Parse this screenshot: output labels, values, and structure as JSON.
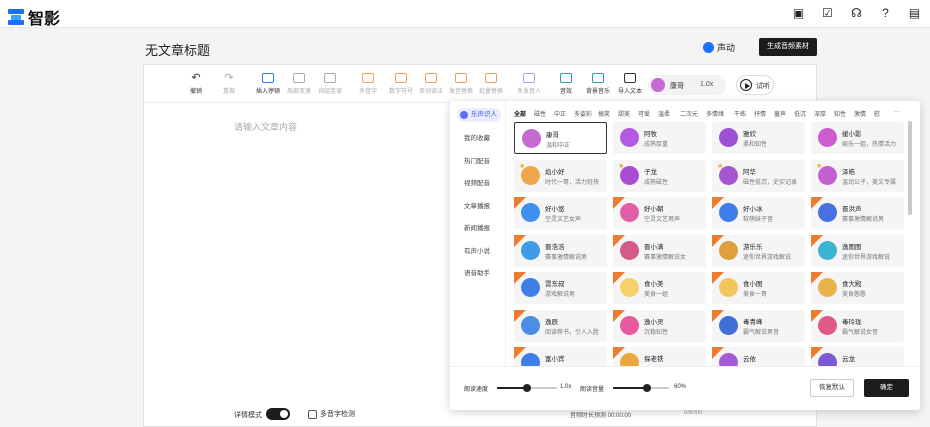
{
  "app": {
    "name": "智影"
  },
  "top_icons": [
    "monitor-icon",
    "task-icon",
    "headset-icon",
    "help-icon",
    "message-icon"
  ],
  "doc": {
    "title": "无文章标题",
    "voice_label": "声动",
    "generate_button": "生成音频素材"
  },
  "toolbar": {
    "undo": "撤销",
    "redo": "重做",
    "insert_pause": "插入停顿",
    "local_speed": "局部变速",
    "continuous_read": "词组连读",
    "polyphone": "多音字",
    "number_symbol": "数字符号",
    "word_replace": "单词读法",
    "pronunciation_replace": "发音替换",
    "batch_replace": "批量替换",
    "multi_speaker": "多发音人",
    "sound_effect": "音效",
    "bg_music": "背景音乐",
    "import_text": "导入文本",
    "speaker_name": "康哥",
    "speed": "1.0x",
    "listen": "试听"
  },
  "editor": {
    "placeholder": "请输入文章内容",
    "detail_mode": "详情模式",
    "polyphone_check": "多音字检测",
    "duration": "音频时长预测 00:00:00",
    "char_count": "0/8000"
  },
  "panel": {
    "active_category": "乐声识人",
    "categories": [
      "我的收藏",
      "热门配音",
      "视频配音",
      "文章播报",
      "新闻播报",
      "有声小说",
      "语音助手"
    ],
    "tabs": [
      "全部",
      "磁性",
      "中正",
      "多姿彩",
      "搞笑",
      "甜美",
      "可爱",
      "温柔",
      "二次元",
      "多情绪",
      "干练",
      "抒情",
      "童声",
      "低沉",
      "深厚",
      "知性",
      "激情",
      "慰",
      "···"
    ],
    "cards": [
      {
        "name": "康哥",
        "desc": "温和中正",
        "color": "#c56ad0",
        "selected": true
      },
      {
        "name": "阿牧",
        "desc": "成熟厚重",
        "color": "#b35be0"
      },
      {
        "name": "雅欣",
        "desc": "柔和知性",
        "color": "#9d4fd6"
      },
      {
        "name": "缓小影",
        "desc": "娱乐一姐，热情活力",
        "color": "#cc5ccf"
      },
      {
        "name": "焰小好",
        "desc": "时代一哥，活力轻快",
        "color": "#f0a64a",
        "star": true
      },
      {
        "name": "子龙",
        "desc": "成熟磁性",
        "color": "#a74cd3",
        "star": true
      },
      {
        "name": "阿华",
        "desc": "磁性低沉，史实记录",
        "color": "#a555cf",
        "star": true
      },
      {
        "name": "泽皓",
        "desc": "温润公子，美文专属",
        "color": "#c45fd2",
        "star": true
      },
      {
        "name": "好小悠",
        "desc": "空灵文艺女声",
        "color": "#3f8ef0",
        "new": true
      },
      {
        "name": "好小朝",
        "desc": "空灵文艺男声",
        "color": "#e05fa6",
        "new": true
      },
      {
        "name": "好小冰",
        "desc": "软萌妹子音",
        "color": "#3f7ee8",
        "new": true
      },
      {
        "name": "晋洪声",
        "desc": "赛事激情解说男",
        "color": "#4a6fe0",
        "new": true
      },
      {
        "name": "晋浩浩",
        "desc": "赛事激情解说男",
        "color": "#3f9be8",
        "new": true
      },
      {
        "name": "晋小满",
        "desc": "赛事激情解说女",
        "color": "#d45a8a",
        "new": true
      },
      {
        "name": "游乐乐",
        "desc": "迷你世界游戏解说",
        "color": "#e0a03c",
        "new": true
      },
      {
        "name": "逸图图",
        "desc": "迷你世界游戏解说",
        "color": "#3cb6d0",
        "new": true
      },
      {
        "name": "霓东叔",
        "desc": "游戏解说男",
        "color": "#3f7ee8",
        "new": true
      },
      {
        "name": "食小美",
        "desc": "美食一姐",
        "color": "#f5d36a",
        "new": true
      },
      {
        "name": "食小图",
        "desc": "美食一哥",
        "color": "#f2c65a",
        "new": true
      },
      {
        "name": "食大殿",
        "desc": "美食憨憨",
        "color": "#e8b44a",
        "new": true
      },
      {
        "name": "逸辰",
        "desc": "阅读荐书，引人入胜",
        "color": "#4a8ee8",
        "new": true
      },
      {
        "name": "逸小灵",
        "desc": "沉稳知性",
        "color": "#e85aa0",
        "new": true
      },
      {
        "name": "毒青峰",
        "desc": "霸气解说男音",
        "color": "#3f6fd8",
        "new": true
      },
      {
        "name": "毒玲珑",
        "desc": "霸气解说女音",
        "color": "#e05a8a",
        "new": true
      },
      {
        "name": "富小宾",
        "desc": "",
        "color": "#3f7ee8",
        "new": true
      },
      {
        "name": "探老铁",
        "desc": "",
        "color": "#e8a83c",
        "new": true
      },
      {
        "name": "云依",
        "desc": "",
        "color": "#a65ad6",
        "new": true
      },
      {
        "name": "云龙",
        "desc": "",
        "color": "#7a5ad6",
        "new": true
      }
    ],
    "speed_label": "朗读速度",
    "speed_value": "1.0x",
    "speed_level": 0.5,
    "volume_label": "朗读音量",
    "volume_value": "60%",
    "volume_level": 0.6,
    "reset": "恢复默认",
    "confirm": "确定"
  }
}
